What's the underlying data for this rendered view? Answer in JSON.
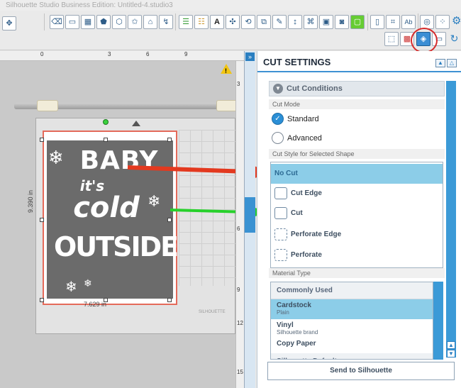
{
  "window": {
    "title": "Silhouette Studio Business Edition: Untitled-4.studio3"
  },
  "toolbar": {
    "icons": [
      "pan-icon",
      "eraser-icon",
      "rectangle-icon",
      "grid-icon",
      "pentagon-icon",
      "polygon-icon",
      "star-icon",
      "shape-icon",
      "arrow-icon",
      "line-color-icon",
      "fill-color-icon",
      "text-icon",
      "weld-icon",
      "rotate-icon",
      "offset-icon",
      "pen-icon",
      "knife-icon",
      "trace-icon",
      "image-icon",
      "fill-icon",
      "crop-icon",
      "page-icon",
      "text-style-icon",
      "spiral-icon",
      "dots-icon",
      "settings-icon"
    ],
    "text_button": "A",
    "text_style_label": "Ab"
  },
  "rulers": {
    "top_ticks": [
      "0",
      "3",
      "6",
      "9"
    ],
    "side_ticks": [
      "3",
      "6",
      "9",
      "12",
      "15"
    ]
  },
  "design": {
    "line1": "BABY",
    "line2": "it's",
    "line3": "cold",
    "line4": "OUTSIDE",
    "height_label": "9.390 in",
    "width_label": "7.629 in",
    "brand": "SILHOUETTE",
    "warning": "!"
  },
  "panel": {
    "title": "CUT SETTINGS",
    "section_title": "Cut Conditions",
    "cut_mode_label": "Cut Mode",
    "modes": [
      {
        "label": "Standard",
        "selected": true
      },
      {
        "label": "Advanced",
        "selected": false
      }
    ],
    "cut_style_label": "Cut Style for Selected Shape",
    "cut_styles": [
      {
        "label": "No Cut",
        "selected": true
      },
      {
        "label": "Cut Edge",
        "selected": false
      },
      {
        "label": "Cut",
        "selected": false
      },
      {
        "label": "Perforate Edge",
        "selected": false
      },
      {
        "label": "Perforate",
        "selected": false
      }
    ],
    "material_type_label": "Material Type",
    "materials_header": "Commonly Used",
    "materials": [
      {
        "name": "Cardstock",
        "sub": "Plain",
        "selected": true
      },
      {
        "name": "Vinyl",
        "sub": "Silhouette brand",
        "selected": false
      },
      {
        "name": "Copy Paper",
        "sub": "",
        "selected": false
      },
      {
        "name": "Silhouette Defaults",
        "sub": "",
        "selected": false
      }
    ],
    "send_button": "Send to Silhouette"
  },
  "colors": {
    "accent": "#2a7fc1",
    "selected_row": "#8ccde8",
    "annotation_red": "#e3391f",
    "annotation_green": "#27d12b"
  }
}
